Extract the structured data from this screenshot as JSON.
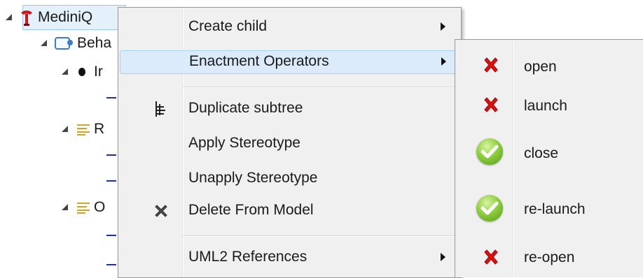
{
  "tree": {
    "root_label": "MediniQ",
    "behavior_label": "Beha",
    "node1_label": "Ir",
    "node2_label": "R",
    "node3_label": "O"
  },
  "menu": {
    "items": [
      {
        "label": "Create child",
        "has_submenu": true
      },
      {
        "label": "Enactment Operators",
        "has_submenu": true,
        "highlighted": true
      },
      {
        "label": "Duplicate subtree",
        "icon": "duplicate-subtree-icon"
      },
      {
        "label": "Apply Stereotype"
      },
      {
        "label": "Unapply Stereotype"
      },
      {
        "label": "Delete From Model",
        "icon": "delete-x-icon"
      },
      {
        "label": "UML2 References",
        "has_submenu": true
      }
    ]
  },
  "submenu": {
    "items": [
      {
        "label": "open",
        "status": "disabled",
        "icon": "red-x-icon"
      },
      {
        "label": "launch",
        "status": "disabled",
        "icon": "red-x-icon"
      },
      {
        "label": "close",
        "status": "enabled",
        "icon": "green-check-icon"
      },
      {
        "label": "re-launch",
        "status": "enabled",
        "icon": "green-check-icon"
      },
      {
        "label": "re-open",
        "status": "disabled",
        "icon": "red-x-icon"
      }
    ]
  },
  "colors": {
    "menu_bg": "#f0f0f0",
    "highlight": "#dcebfb",
    "selection_border": "#99c9ef",
    "red_x": "#e0100e",
    "green_check": "#6ab82a"
  }
}
